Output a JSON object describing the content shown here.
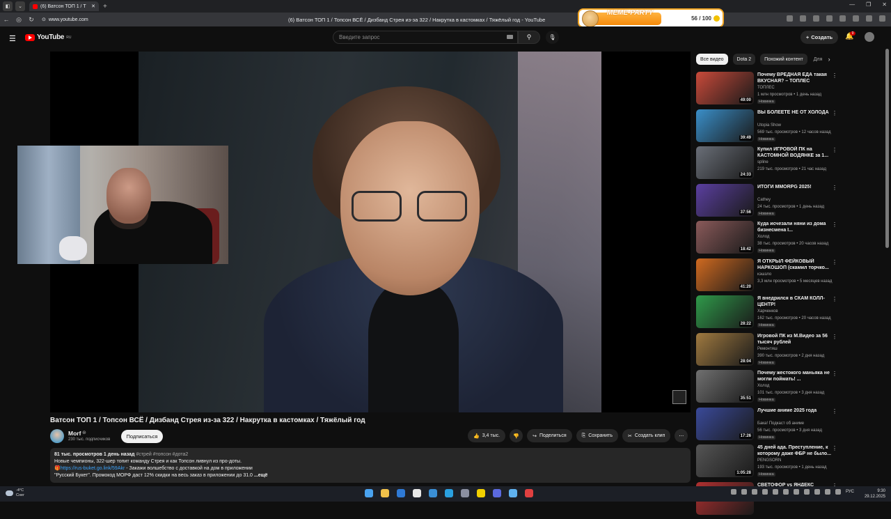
{
  "browser": {
    "tab_title": "(6) Ватсон ТОП 1 / Т",
    "url": "www.youtube.com",
    "page_title": "(6) Ватсон ТОП 1 / Топсон ВСЁ / Дизбанд Стрея из-за 322 / Накрутка в кастомках / Тяжёлый год - YouTube"
  },
  "meme_party": {
    "title": "MEME-PARTY",
    "score": "56 / 100",
    "progress_fraction": 0.56
  },
  "header": {
    "logo_text": "YouTube",
    "logo_region": "RU",
    "search_placeholder": "Введите запрос",
    "create_label": "Создать",
    "notification_count": "9"
  },
  "video": {
    "title": "Ватсон ТОП 1 / Топсон ВСЁ / Дизбанд Стрея из-за 322 / Накрутка в кастомках / Тяжёлый год",
    "channel": "Morf",
    "subscribers": "230 тыс. подписчиков",
    "subscribe_label": "Подписаться",
    "likes": "3,4 тыс.",
    "share_label": "Поделиться",
    "save_label": "Сохранить",
    "clip_label": "Создать клип"
  },
  "description": {
    "meta": "81 тыс. просмотров  1 день назад",
    "tags": "#стрей #топсон #дота2",
    "line1": "Новые чемпионы, 322-шер топит команду Стрея и как Топсон ливнул из про-доты.",
    "gift": "🎁",
    "link": "https://rus-buket.go.link/59Akr",
    "line2_rest": " - Закажи волшебство с доставкой на дом в приложении",
    "line3": "\"Русский Букет\". Промокод МОРФ даст 12% скидки на весь заказ в приложении до 31.0",
    "more": "...ещё"
  },
  "chips": [
    "Все видео",
    "Dota 2",
    "Похожий контент",
    "Для"
  ],
  "recommendations": [
    {
      "title": "Почему ВРЕДНАЯ ЕДА такая ВКУСНАЯ? – ТОПЛЕС",
      "channel": "ТОПЛЕС",
      "meta": "1 млн просмотров • 1 день назад",
      "badge": "Новинка",
      "duration": "49:00",
      "color": "#c94a3a"
    },
    {
      "title": "ВЫ БОЛЕЕТЕ НЕ ОТ ХОЛОДА",
      "channel": "Utopia Show",
      "meta": "569 тыс. просмотров • 12 часов назад",
      "badge": "Новинка",
      "duration": "39:49",
      "color": "#3a8fc9"
    },
    {
      "title": "Купил ИГРОВОЙ ПК на КАСТОМНОЙ ВОДЯНКЕ за 1...",
      "channel": "spline",
      "meta": "219 тыс. просмотров • 21 час назад",
      "badge": "",
      "duration": "24:33",
      "color": "#6a6f78"
    },
    {
      "title": "ИТОГИ MMORPG 2025!",
      "channel": "Cathey",
      "meta": "24 тыс. просмотров • 1 день назад",
      "badge": "Новинка",
      "duration": "37:56",
      "color": "#5b3fa0"
    },
    {
      "title": "Куда исчезали няни из дома бизнесмена I...",
      "channel": "Холод",
      "meta": "38 тыс. просмотров • 20 часов назад",
      "badge": "Новинка",
      "duration": "18:42",
      "color": "#8a5a5a"
    },
    {
      "title": "Я ОТКРЫЛ ФЕЙКОВЫЙ НАРКОШОП (скамил торчко...",
      "channel": "кэшзло",
      "meta": "3,3 млн просмотров • 5 месяцев назад",
      "badge": "",
      "duration": "41:20",
      "color": "#d06a20"
    },
    {
      "title": "Я внедрился в СКАМ КОЛЛ-ЦЕНТР!",
      "channel": "Харченков",
      "meta": "162 тыс. просмотров • 20 часов назад",
      "badge": "Новинка",
      "duration": "28:22",
      "color": "#2f9a4a"
    },
    {
      "title": "Игровой ПК из М.Видео за 56 тысяч рублей",
      "channel": "Ремонтяш",
      "meta": "390 тыс. просмотров • 2 дня назад",
      "badge": "Новинка",
      "duration": "28:04",
      "color": "#a07a40"
    },
    {
      "title": "Почему жестокого маньяка не могли поймать! ...",
      "channel": "Холод",
      "meta": "101 тыс. просмотров • 3 дня назад",
      "badge": "Новинка",
      "duration": "35:51",
      "color": "#707070"
    },
    {
      "title": "Лучшие аниме 2025 года",
      "channel": "Бака! Подкаст об аниме",
      "meta": "56 тыс. просмотров • 3 дня назад",
      "badge": "Новинка",
      "duration": "17:26",
      "color": "#3a4a9a"
    },
    {
      "title": "45 дней ада. Преступление, к которому даже ФБР не было...",
      "channel": "PENGSORN",
      "meta": "193 тыс. просмотров • 1 день назад",
      "badge": "Новинка",
      "duration": "1:05:28",
      "color": "#555555"
    },
    {
      "title": "СВЕТОФОР vs ЯНДЕКС ЛАВКА",
      "channel": "",
      "meta": "",
      "badge": "",
      "duration": "",
      "color": "#b03030"
    }
  ],
  "taskbar": {
    "temp": "-4°C",
    "weather": "Снег",
    "lang": "РУС",
    "time": "9:30",
    "date": "29.12.2025",
    "app_colors": [
      "#4aa3f0",
      "#f0c04a",
      "#2f7ad6",
      "#e8e8e8",
      "#3a8fd6",
      "#2aa0e0",
      "#8a8fa0",
      "#f2d000",
      "#5b6ae0",
      "#5fb2f0",
      "#e04040"
    ]
  }
}
